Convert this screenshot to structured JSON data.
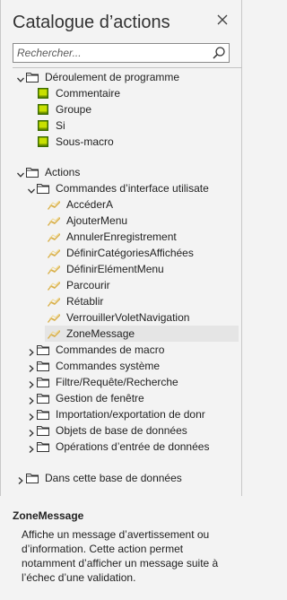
{
  "header": {
    "title": "Catalogue d’actions",
    "close_icon": "close-icon"
  },
  "search": {
    "placeholder": "Rechercher...",
    "value": "",
    "icon": "search-icon"
  },
  "tree": {
    "programme": {
      "label": "Déroulement de programme",
      "items": [
        "Commentaire",
        "Groupe",
        "Si",
        "Sous-macro"
      ]
    },
    "actions": {
      "label": "Actions",
      "ui_commands": {
        "label": "Commandes d’interface utilisate",
        "items": [
          "AccéderA",
          "AjouterMenu",
          "AnnulerEnregistrement",
          "DéfinirCatégoriesAffichées",
          "DéfinirElémentMenu",
          "Parcourir",
          "Rétablir",
          "VerrouillerVoletNavigation",
          "ZoneMessage"
        ],
        "selected": "ZoneMessage"
      },
      "categories": [
        "Commandes de macro",
        "Commandes système",
        "Filtre/Requête/Recherche",
        "Gestion de fenêtre",
        "Importation/exportation de donr",
        "Objets de base de données",
        "Opérations d’entrée de données"
      ]
    },
    "database": {
      "label": "Dans cette base de données"
    }
  },
  "description": {
    "title": "ZoneMessage",
    "text": "Affiche un message d’avertissement ou d’information. Cette action permet notamment d’afficher un message suite à l’échec d’une validation."
  },
  "colors": {
    "pane_bg": "#f3f3f3",
    "flow_icon_fill": "#c8e000",
    "flow_icon_border": "#3a6b00",
    "action_icon": "#d9b04a",
    "selected_bg": "#e5e5e5"
  }
}
